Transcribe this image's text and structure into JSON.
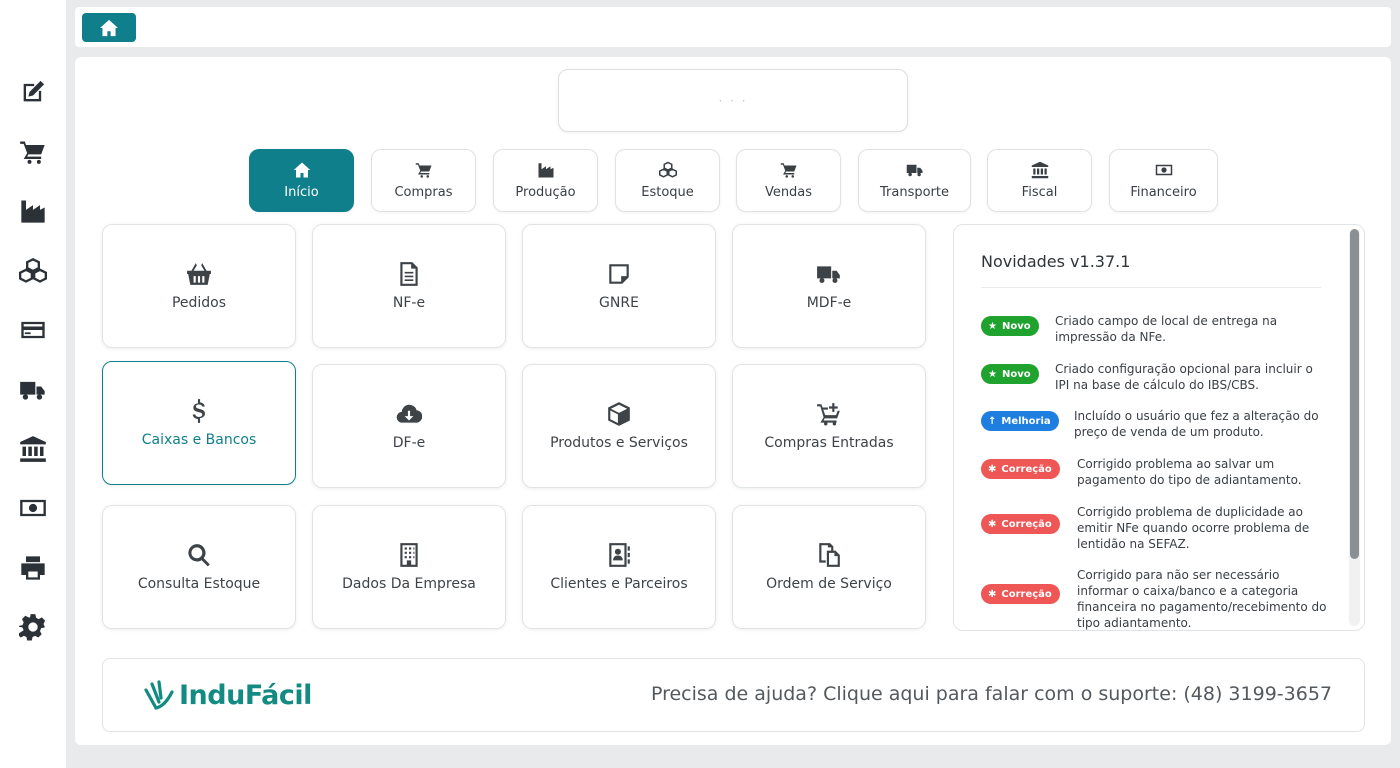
{
  "sidebar": {
    "icons": [
      "edit-icon",
      "cart-icon",
      "factory-icon",
      "boxes-icon",
      "credit-card-icon",
      "truck-icon",
      "bank-icon",
      "money-icon",
      "printer-icon",
      "gear-icon"
    ]
  },
  "search": {
    "placeholder": "· · ·"
  },
  "tabs": [
    {
      "label": "Início",
      "icon": "home-icon"
    },
    {
      "label": "Compras",
      "icon": "cart-icon"
    },
    {
      "label": "Produção",
      "icon": "factory-icon"
    },
    {
      "label": "Estoque",
      "icon": "boxes-icon"
    },
    {
      "label": "Vendas",
      "icon": "cart-icon"
    },
    {
      "label": "Transporte",
      "icon": "truck-icon"
    },
    {
      "label": "Fiscal",
      "icon": "bank-icon"
    },
    {
      "label": "Financeiro",
      "icon": "money-icon"
    }
  ],
  "cards": [
    {
      "label": "Pedidos",
      "icon": "basket-icon"
    },
    {
      "label": "NF-e",
      "icon": "document-icon"
    },
    {
      "label": "GNRE",
      "icon": "note-icon"
    },
    {
      "label": "MDF-e",
      "icon": "truck-icon"
    },
    {
      "label": "Caixas e Bancos",
      "icon": "dollar-icon"
    },
    {
      "label": "DF-e",
      "icon": "cloud-download-icon"
    },
    {
      "label": "Produtos e Serviços",
      "icon": "box-icon"
    },
    {
      "label": "Compras Entradas",
      "icon": "cart-plus-icon"
    },
    {
      "label": "Consulta Estoque",
      "icon": "search-icon"
    },
    {
      "label": "Dados Da Empresa",
      "icon": "building-icon"
    },
    {
      "label": "Clientes e Parceiros",
      "icon": "contact-book-icon"
    },
    {
      "label": "Ordem de Serviço",
      "icon": "file-copy-icon"
    }
  ],
  "news": {
    "title": "Novidades v1.37.1",
    "items": [
      {
        "badge": "Novo",
        "badge_icon": "★",
        "color": "#1fa32e",
        "lines": [
          "Criado campo de local de entrega na",
          "impressão da NFe."
        ]
      },
      {
        "badge": "Novo",
        "badge_icon": "★",
        "color": "#1fa32e",
        "lines": [
          "Criado configuração opcional para incluir o",
          "IPI na base de cálculo do IBS/CBS."
        ]
      },
      {
        "badge": "Melhoria",
        "badge_icon": "↑",
        "color": "#1e7fe0",
        "lines": [
          "Incluído o usuário que fez a alteração do",
          "preço de venda de um produto."
        ]
      },
      {
        "badge": "Correção",
        "badge_icon": "✱",
        "color": "#ef5656",
        "lines": [
          "Corrigido problema ao salvar um",
          "pagamento do tipo de adiantamento."
        ]
      },
      {
        "badge": "Correção",
        "badge_icon": "✱",
        "color": "#ef5656",
        "lines": [
          "Corrigido problema de duplicidade ao",
          "emitir NFe quando ocorre problema de",
          "lentidão na SEFAZ."
        ]
      },
      {
        "badge": "Correção",
        "badge_icon": "✱",
        "color": "#ef5656",
        "lines": [
          "Corrigido para não ser necessário",
          "informar o caixa/banco e a categoria",
          "financeira no pagamento/recebimento do",
          "tipo adiantamento."
        ]
      }
    ]
  },
  "footer": {
    "logo_text": "InduFácil",
    "support_text": "Precisa de ajuda? Clique aqui para falar com o suporte: (48) 3199-3657"
  },
  "colors": {
    "primary": "#107f8c",
    "novo": "#1fa32e",
    "melhoria": "#1e7fe0",
    "correcao": "#ef5656"
  }
}
